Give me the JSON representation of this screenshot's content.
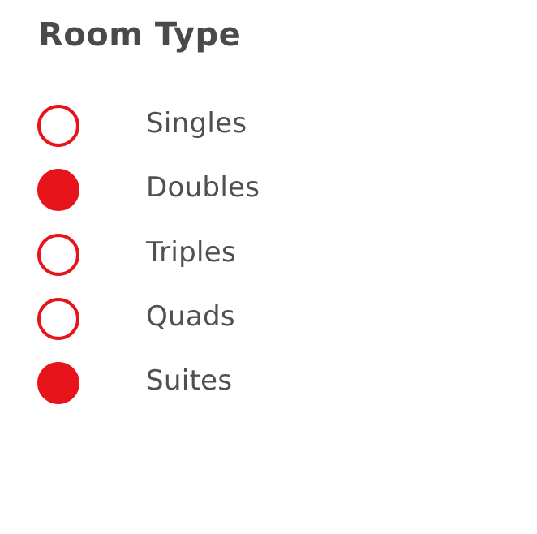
{
  "title": "Room Type",
  "accent_color": "#e8141b",
  "options": [
    {
      "label": "Singles",
      "checked": false
    },
    {
      "label": "Doubles",
      "checked": true
    },
    {
      "label": "Triples",
      "checked": false
    },
    {
      "label": "Quads",
      "checked": false
    },
    {
      "label": "Suites",
      "checked": true
    }
  ]
}
